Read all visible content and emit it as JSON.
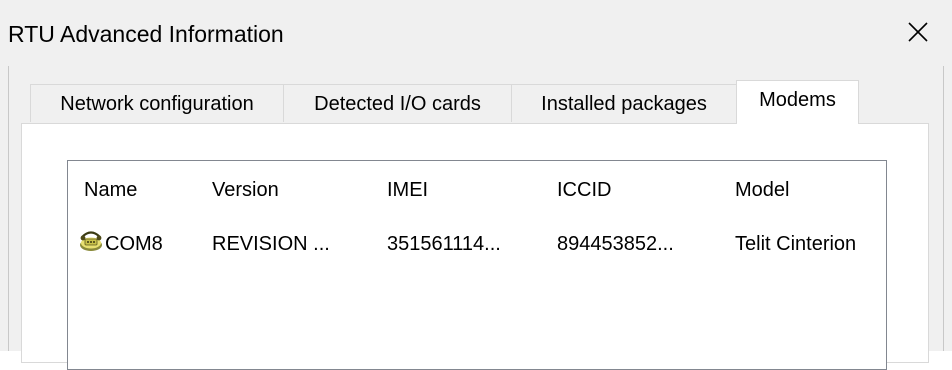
{
  "window": {
    "title": "RTU Advanced Information"
  },
  "tabs": [
    {
      "label": "Network configuration"
    },
    {
      "label": "Detected I/O cards"
    },
    {
      "label": "Installed packages"
    },
    {
      "label": "Modems"
    }
  ],
  "active_tab": "Modems",
  "table": {
    "columns": [
      "Name",
      "Version",
      "IMEI",
      "ICCID",
      "Model"
    ],
    "rows": [
      {
        "icon": "modem-icon",
        "name": "COM8",
        "version": "REVISION ...",
        "imei": "351561114...",
        "iccid": "894453852...",
        "model": "Telit Cinterion"
      }
    ]
  },
  "icons": {
    "close": "close-icon",
    "row_icon": "modem-icon"
  }
}
